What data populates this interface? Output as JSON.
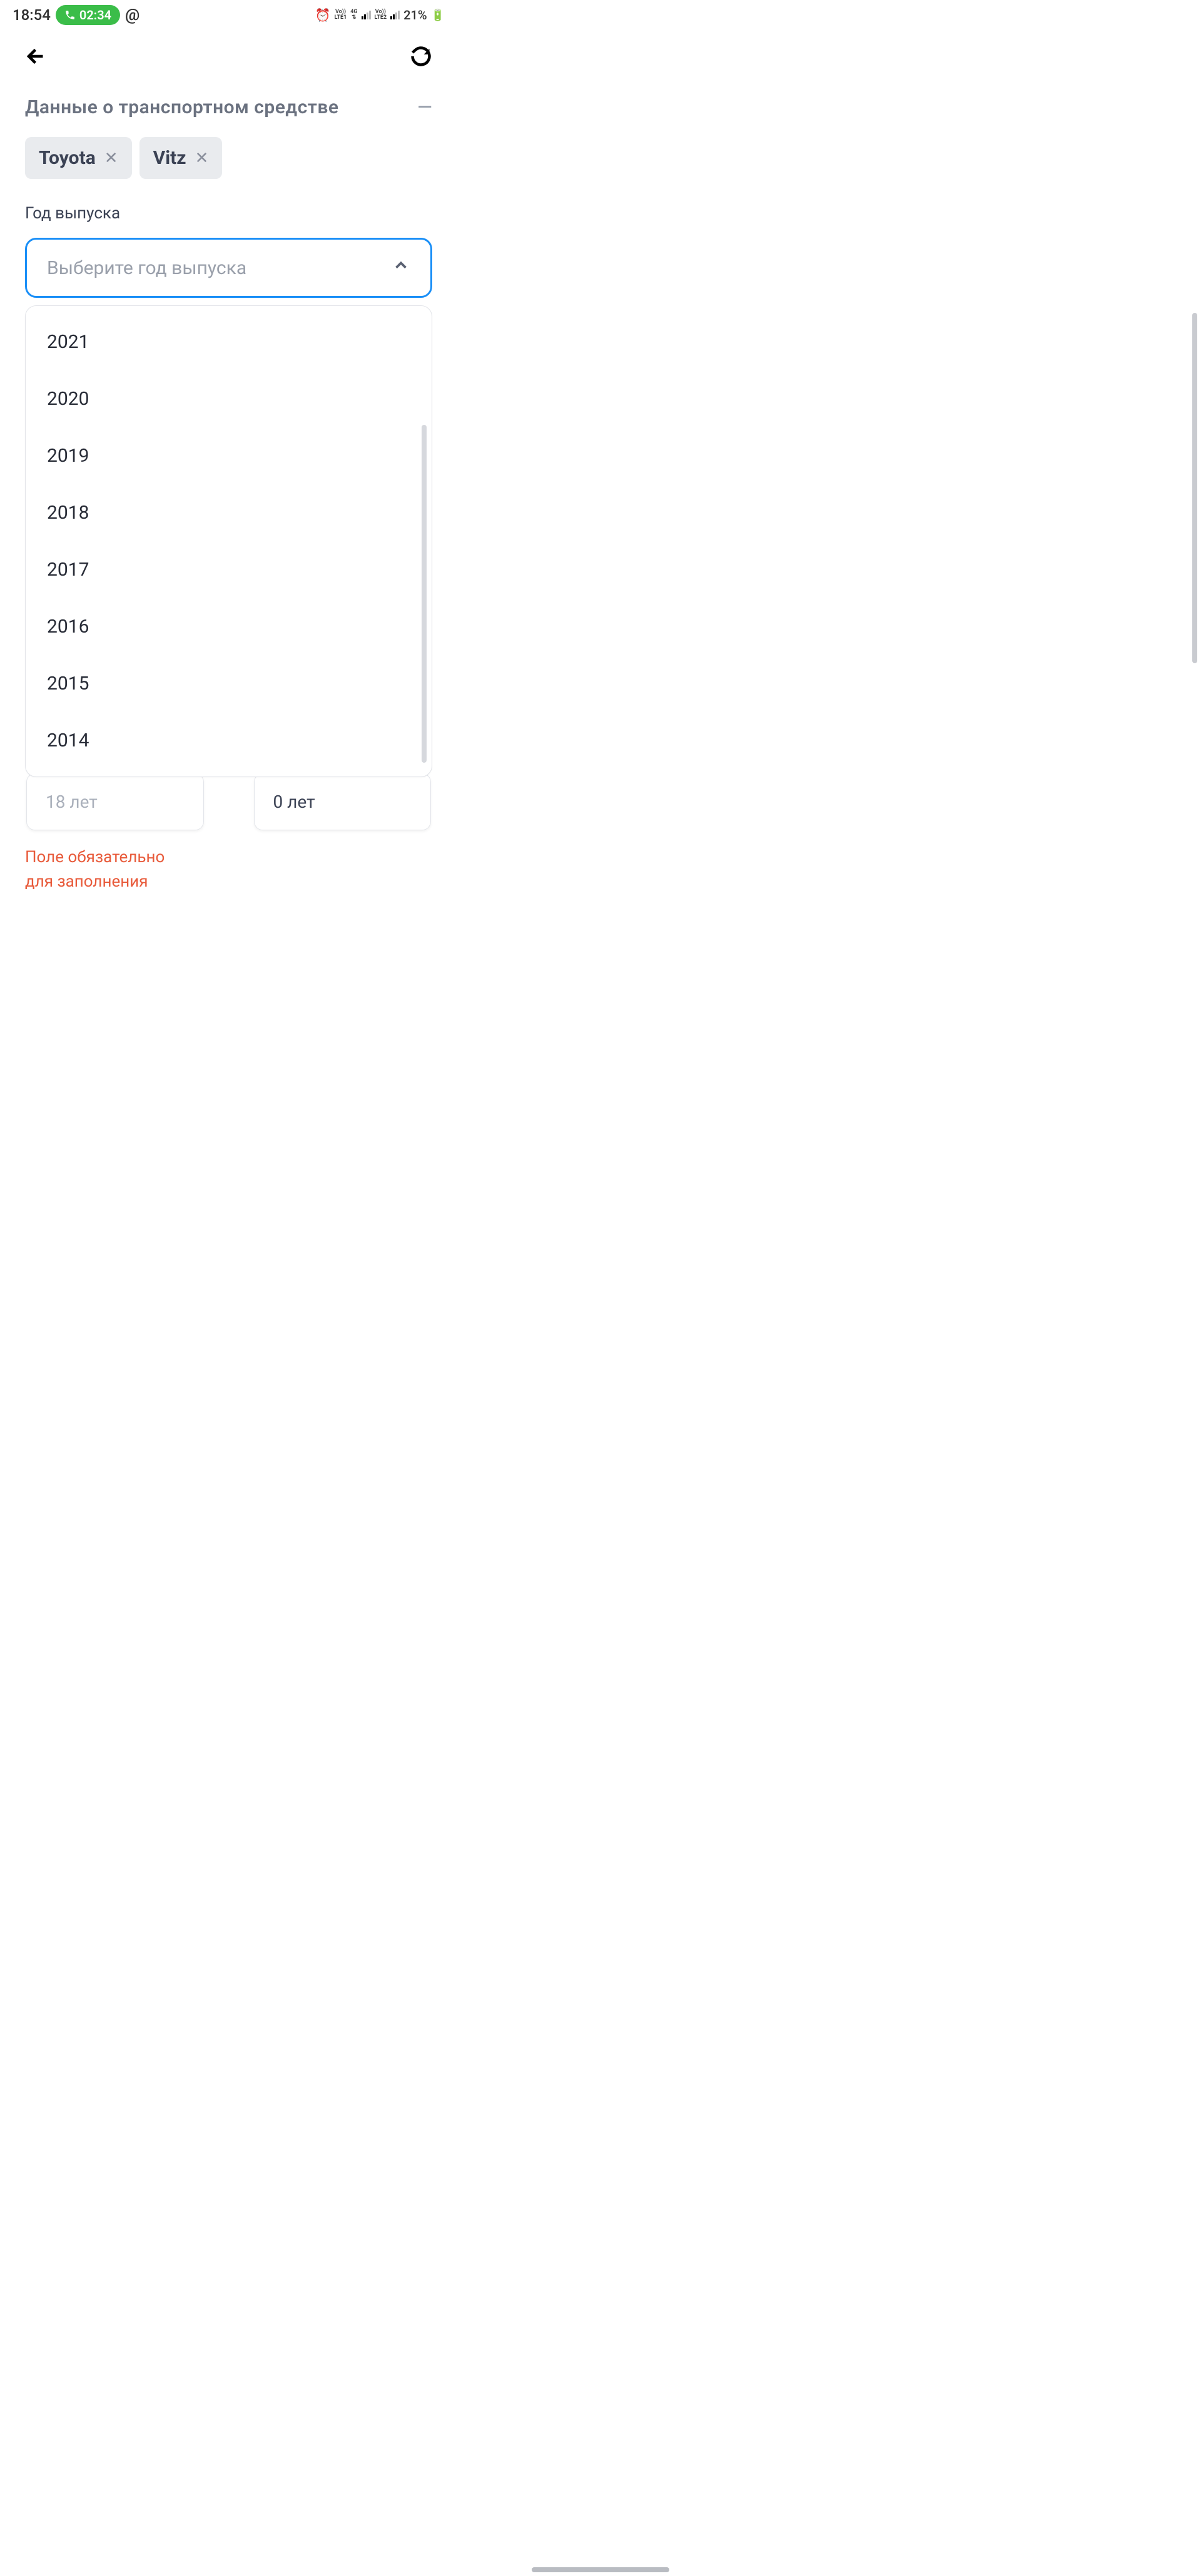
{
  "status": {
    "time": "18:54",
    "call_duration": "02:34",
    "at_symbol": "@",
    "lte1_vo": "Vo))",
    "lte1": "LTE1",
    "net_4g": "4G",
    "lte2_vo": "Vo))",
    "lte2": "LTE2",
    "battery_pct": "21%"
  },
  "section": {
    "title": "Данные о транспортном средстве"
  },
  "chips": {
    "brand": "Toyota",
    "model": "Vitz"
  },
  "year": {
    "label": "Год выпуска",
    "placeholder": "Выберите год выпуска",
    "options": [
      "2021",
      "2020",
      "2019",
      "2018",
      "2017",
      "2016",
      "2015",
      "2014"
    ]
  },
  "bottom": {
    "left": "18 лет",
    "right": "0 лет"
  },
  "error": {
    "line1": "Поле обязательно",
    "line2": "для заполнения"
  }
}
